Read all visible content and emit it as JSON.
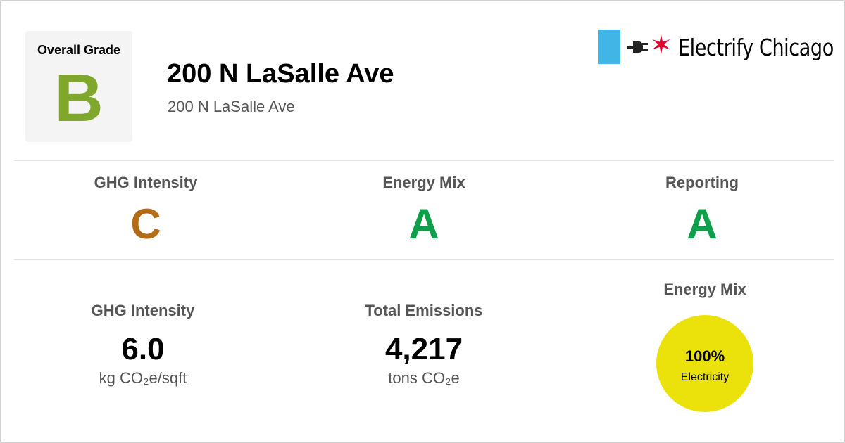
{
  "overall_grade": {
    "label": "Overall Grade",
    "value": "B",
    "color": "#7fa72b"
  },
  "building": {
    "name": "200 N LaSalle Ave",
    "address": "200 N LaSalle Ave"
  },
  "logo": {
    "text": "Electrify Chicago",
    "icons": [
      "chicago-flag-stripe",
      "plug-icon",
      "chicago-star-icon"
    ],
    "colors": {
      "stripe": "#41b6e6",
      "star": "#e4002b"
    }
  },
  "grades": [
    {
      "label": "GHG Intensity",
      "value": "C",
      "color": "#b36b16"
    },
    {
      "label": "Energy Mix",
      "value": "A",
      "color": "#0e9f4b"
    },
    {
      "label": "Reporting",
      "value": "A",
      "color": "#0e9f4b"
    }
  ],
  "metrics": {
    "ghg_intensity": {
      "label": "GHG Intensity",
      "value": "6.0",
      "unit": "kg CO₂e/sqft"
    },
    "total_emissions": {
      "label": "Total Emissions",
      "value": "4,217",
      "unit": "tons CO₂e"
    }
  },
  "energy_mix": {
    "label": "Energy Mix",
    "percent_label": "100%",
    "source_label": "Electricity",
    "chart_data": {
      "type": "pie",
      "categories": [
        "Electricity"
      ],
      "values": [
        100
      ],
      "colors": [
        "#ebe10b"
      ]
    }
  }
}
